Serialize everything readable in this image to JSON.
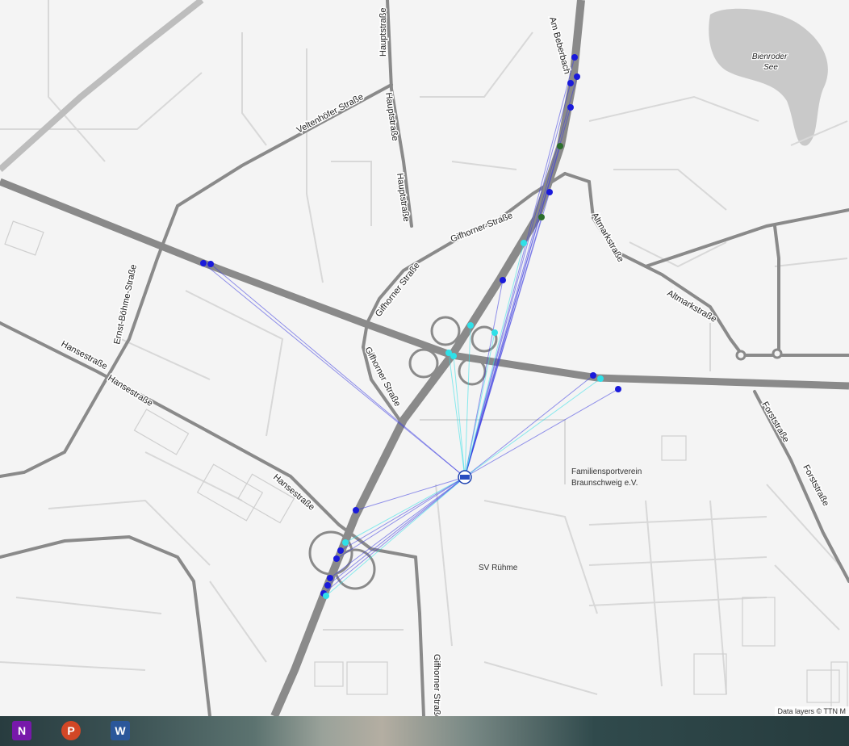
{
  "map": {
    "street_labels": [
      "Veltenhöfer Straße",
      "Hauptstraße",
      "Hauptstraße",
      "Hauptstraße",
      "Am Beberbach",
      "Gifhorner Straße",
      "Gifhorner Straße",
      "Gifhorner Straße",
      "Gifhorner Straße",
      "Altmarkstraße",
      "Altmarkstraße",
      "Ernst-Böhme-Straße",
      "Hansestraße",
      "Hansestraße",
      "Hansestraße",
      "Forststraße",
      "Forststraße"
    ],
    "lake_label": "Bienroder See",
    "place_labels": [
      "Familiensportverein Braunschweig e.V.",
      "SV Rühme"
    ],
    "colors": {
      "dark_blue": "#1a1adb",
      "cyan": "#2fe0e8",
      "dark_green": "#2c6e2c",
      "road": "#8a8a8a"
    }
  },
  "attribution": "Data layers © TTN M",
  "taskbar": {
    "apps": [
      {
        "name": "OneNote",
        "letter": "N",
        "icon": "onenote-icon"
      },
      {
        "name": "PowerPoint",
        "letter": "P",
        "icon": "powerpoint-icon"
      },
      {
        "name": "Word",
        "letter": "W",
        "icon": "word-icon"
      }
    ]
  }
}
